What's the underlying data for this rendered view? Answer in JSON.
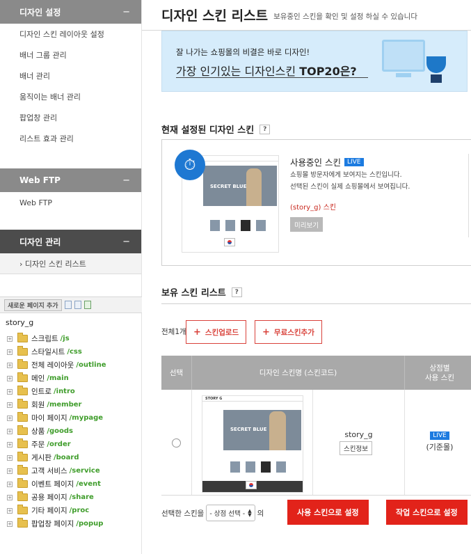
{
  "sidebar": {
    "design_settings": {
      "title": "디자인 설정",
      "collapse": "−",
      "items": [
        "디자인 스킨 레이아웃 설정",
        "배너 그룹 관리",
        "배너 관리",
        "움직이는 배너 관리",
        "팝업창 관리",
        "리스트 효과 관리"
      ]
    },
    "web_ftp": {
      "title": "Web FTP",
      "collapse": "−",
      "items": [
        "Web FTP"
      ]
    },
    "design_manage": {
      "title": "디자인 관리",
      "collapse": "−",
      "items": [
        "› 디자인 스킨 리스트"
      ]
    },
    "new_page_button": "새로운 페이지 추가",
    "tree_root": "story_g",
    "tree": [
      {
        "label": "스크립트",
        "path": "/js"
      },
      {
        "label": "스타일시트",
        "path": "/css"
      },
      {
        "label": "전체 레이아웃",
        "path": "/outline"
      },
      {
        "label": "메인",
        "path": "/main"
      },
      {
        "label": "인트로",
        "path": "/intro"
      },
      {
        "label": "회원",
        "path": "/member"
      },
      {
        "label": "마이 페이지",
        "path": "/mypage"
      },
      {
        "label": "상품",
        "path": "/goods"
      },
      {
        "label": "주문",
        "path": "/order"
      },
      {
        "label": "게시판",
        "path": "/board"
      },
      {
        "label": "고객 서비스",
        "path": "/service"
      },
      {
        "label": "이벤트 페이지",
        "path": "/event"
      },
      {
        "label": "공용 페이지",
        "path": "/share"
      },
      {
        "label": "기타 페이지",
        "path": "/proc"
      },
      {
        "label": "팝업창 페이지",
        "path": "/popup"
      }
    ]
  },
  "main": {
    "title": "디자인 스킨 리스트",
    "subtitle": "보유중인 스킨을 확인 및 설정 하실 수 있습니다",
    "banner": {
      "line1": "잘 나가는 쇼핑몰의 비결은 바로 디자인!",
      "line2_prefix": "가장 인기있는 디자인스킨 ",
      "line2_bold": "TOP20은?"
    },
    "current": {
      "heading": "현재 설정된 디자인 스킨",
      "help": "?",
      "using_title": "사용중인 스킨",
      "live": "LIVE",
      "desc1": "쇼핑몰 방문자에게 보여지는 스킨입니다.",
      "desc2": "선택된 스킨이 실제 쇼핑몰에서 보여집니다.",
      "skin_code": "(story_g) 스킨",
      "preview": "미리보기",
      "thumb_text": "SECRET BLUE"
    },
    "owned": {
      "heading": "보유 스킨 리스트",
      "help": "?",
      "count": "전체1개",
      "upload_btn": "스킨업로드",
      "free_btn": "무료스킨추가",
      "plus": "+",
      "columns": [
        "선택",
        "디자인 스킨명 (스킨코드)",
        "상점별\n사용 스킨"
      ],
      "rows": [
        {
          "name": "story_g",
          "info_btn": "스킨정보",
          "live": "LIVE",
          "mall": "(기준몰)",
          "thumb_brand": "STORY G",
          "thumb_text": "SECRET BLUE"
        }
      ]
    },
    "bottom": {
      "prefix": "선택한 스킨을",
      "select_value": "- 상점 선택 -",
      "suffix": "의",
      "use_btn": "사용 스킨으로 설정",
      "work_btn": "작업 스킨으로 설정"
    }
  }
}
